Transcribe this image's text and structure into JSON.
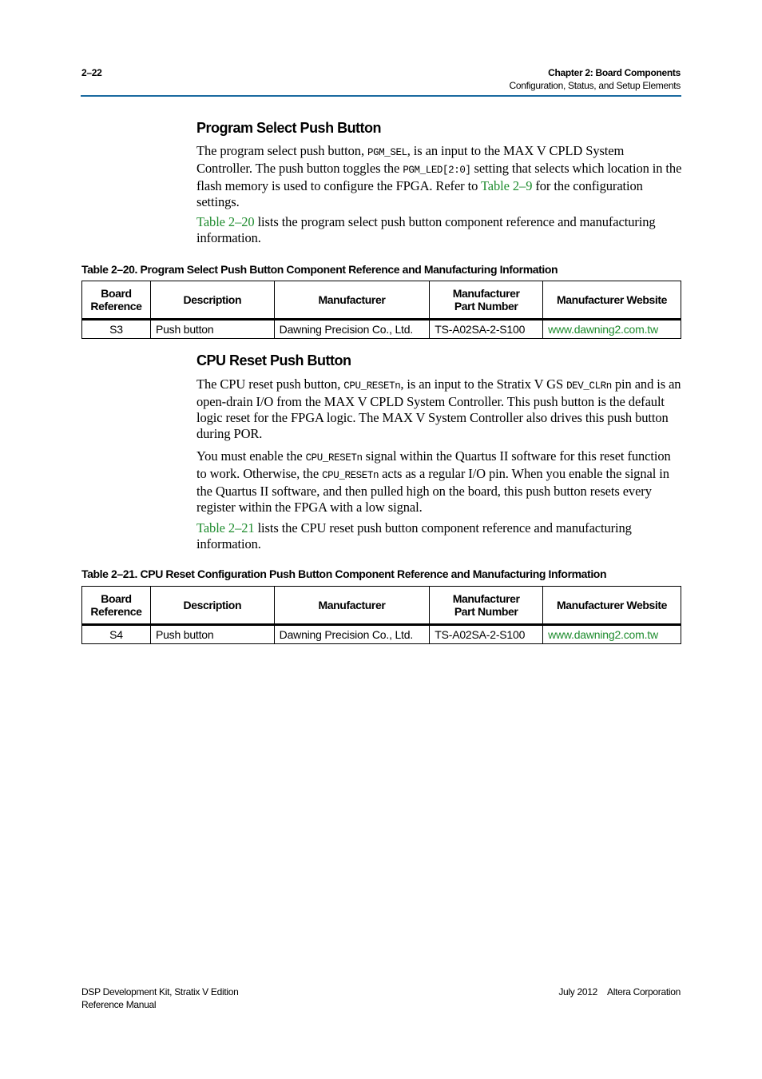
{
  "header": {
    "page_number": "2–22",
    "chapter": "Chapter 2:  Board Components",
    "section": "Configuration, Status, and Setup Elements",
    "rule_color": "#1a6aa0"
  },
  "link_color": "#1e8c2e",
  "sections": [
    {
      "title": "Program Select Push Button",
      "para1": {
        "t1": "The program select push button, ",
        "c1": "PGM_SEL",
        "t2": ", is an input to the MAX V CPLD System Controller. The push button toggles the ",
        "c2": "PGM_LED[2:0]",
        "t3": " setting that selects which location in the flash memory is used to configure the FPGA. Refer to ",
        "link": "Table 2–9",
        "t4": " for the configuration settings."
      },
      "para2": {
        "link": "Table 2–20",
        "t1": " lists the program select push button component reference and manufacturing information."
      }
    },
    {
      "title": "CPU Reset Push Button",
      "para1": {
        "t1": "The CPU reset push button, ",
        "c1": "CPU_RESETn",
        "t2": ", is an input to the Stratix V GS ",
        "c2": "DEV_CLRn",
        "t3": " pin and is an open-drain I/O from the MAX V CPLD System Controller. This push button is the default logic reset for the FPGA logic.  The MAX V System Controller also drives this push button during POR."
      },
      "para2": {
        "t1": "You must enable the ",
        "c1": "CPU_RESETn",
        "t2": " signal within the Quartus II software for this reset function to work. Otherwise, the ",
        "c2": "CPU_RESETn",
        "t3": " acts as a regular I/O pin. When you enable the signal in the Quartus II software, and then pulled high on the board, this push button resets every register within the FPGA with a low signal."
      },
      "para3": {
        "link": "Table 2–21",
        "t1": " lists the CPU reset push button component reference and manufacturing information."
      }
    }
  ],
  "tables": [
    {
      "caption": "Table 2–20.  Program Select Push Button Component Reference and Manufacturing Information",
      "headers": [
        "Board Reference",
        "Description",
        "Manufacturer",
        "Manufacturer Part Number",
        "Manufacturer Website"
      ],
      "header_lines": [
        [
          "Board",
          "Reference"
        ],
        [
          "Description"
        ],
        [
          "Manufacturer"
        ],
        [
          "Manufacturer",
          "Part Number"
        ],
        [
          "Manufacturer Website"
        ]
      ],
      "rows": [
        [
          "S3",
          "Push button",
          "Dawning Precision Co., Ltd.",
          "TS-A02SA-2-S100",
          "www.dawning2.com.tw"
        ]
      ]
    },
    {
      "caption": "Table 2–21.  CPU Reset Configuration Push Button Component Reference and Manufacturing Information",
      "headers": [
        "Board Reference",
        "Description",
        "Manufacturer",
        "Manufacturer Part Number",
        "Manufacturer Website"
      ],
      "header_lines": [
        [
          "Board",
          "Reference"
        ],
        [
          "Description"
        ],
        [
          "Manufacturer"
        ],
        [
          "Manufacturer",
          "Part Number"
        ],
        [
          "Manufacturer Website"
        ]
      ],
      "rows": [
        [
          "S4",
          "Push button",
          "Dawning Precision Co., Ltd.",
          "TS-A02SA-2-S100",
          "www.dawning2.com.tw"
        ]
      ]
    }
  ],
  "footer": {
    "left_line1": "DSP Development Kit, Stratix V Edition",
    "left_line2": "Reference Manual",
    "date": "July 2012",
    "company": "Altera Corporation"
  }
}
